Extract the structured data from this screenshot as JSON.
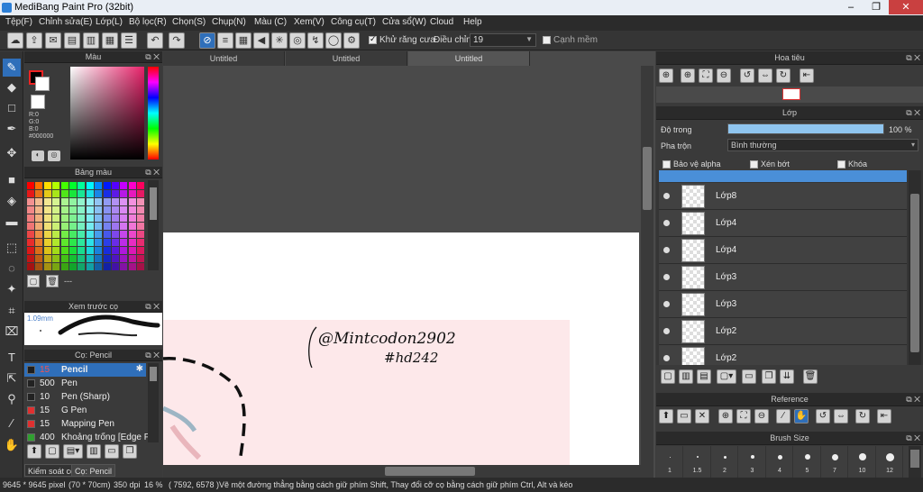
{
  "window": {
    "title": "MediBang Paint Pro (32bit)",
    "controls": [
      "–",
      "❐",
      "✕"
    ]
  },
  "menu": [
    "Tệp(F)",
    "Chỉnh sửa(E)",
    "Lớp(L)",
    "Bộ lọc(R)",
    "Chọn(S)",
    "Chụp(N)",
    "Màu (C)",
    "Xem(V)",
    "Công cụ(T)",
    "Cửa sổ(W)",
    "Cloud",
    "Help"
  ],
  "toolbar": {
    "antialias_label": "Khử răng cưa",
    "adjust_label": "Điều chỉnh",
    "adjust_value": "19",
    "fine_edge_label": "Cạnh mềm"
  },
  "color_panel": {
    "title": "Màu",
    "r": "R:0",
    "g": "G:0",
    "b": "B:0",
    "hex": "#000000"
  },
  "palette_panel": {
    "title": "Bảng màu",
    "extra": "---"
  },
  "brush_preview": {
    "title": "Xem trước cọ",
    "size": "1.09mm"
  },
  "brush_panel": {
    "title": "Cọ: Pencil",
    "items": [
      {
        "size": "15",
        "name": "Pencil",
        "color": "#1e1e1e"
      },
      {
        "size": "500",
        "name": "Pen",
        "color": "#222222"
      },
      {
        "size": "10",
        "name": "Pen (Sharp)",
        "color": "#222222"
      },
      {
        "size": "15",
        "name": "G Pen",
        "color": "#e03030"
      },
      {
        "size": "15",
        "name": "Mapping Pen",
        "color": "#e03030"
      },
      {
        "size": "400",
        "name": "Khoảng trống [Edge Pe",
        "color": "#30a030"
      }
    ]
  },
  "left_tabs": [
    "Kiểm soát co",
    "Cọ: Pencil"
  ],
  "doc_tabs": [
    "Untitled",
    "Untitled",
    "Untitled"
  ],
  "canvas": {
    "signature_line1": "@Mintcodon2902",
    "signature_line2": "#hd242"
  },
  "navigator": {
    "title": "Hoa tiêu"
  },
  "layer_panel": {
    "title": "Lớp",
    "opacity_label": "Độ trong",
    "opacity_value": "100 %",
    "opacity_fraction": 1.0,
    "blend_label": "Pha trộn",
    "blend_value": "Bình thường",
    "protect_alpha": "Bảo vệ alpha",
    "clipping": "Xén bớt",
    "lock": "Khóa",
    "layers": [
      "Lớp8",
      "Lớp4",
      "Lớp4",
      "Lớp3",
      "Lớp3",
      "Lớp2",
      "Lớp2"
    ]
  },
  "reference_panel": {
    "title": "Reference"
  },
  "brush_size_panel": {
    "title": "Brush Size",
    "sizes": [
      "1",
      "1.5",
      "2",
      "3",
      "4",
      "5",
      "7",
      "10",
      "12"
    ]
  },
  "status": {
    "size": "9645 * 9645 pixel",
    "cm": "(70 * 70cm)",
    "dpi": "350 dpi",
    "zoom": "16 %",
    "coords": "( 7592, 6578 )",
    "hint": "Vẽ một đường thẳng bằng cách giữ phím Shift, Thay đổi cỡ cọ bằng cách giữ phím Ctrl, Alt và kéo"
  },
  "colors": {
    "accent": "#2f6fba",
    "canvas_paper": "#ffffff",
    "pink_layer": "#fde8ea"
  }
}
